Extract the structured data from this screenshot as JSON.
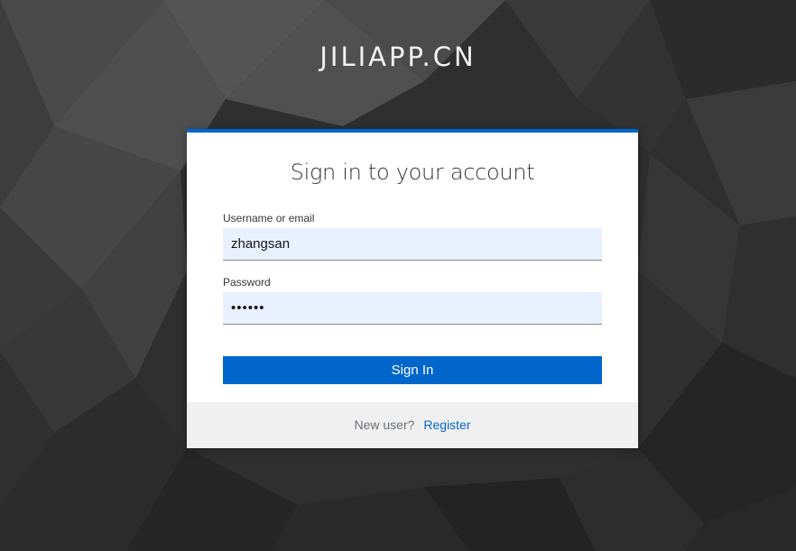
{
  "brand": {
    "title": "JILIAPP.CN"
  },
  "login": {
    "heading": "Sign in to your account",
    "username_label": "Username or email",
    "username_value": "zhangsan",
    "password_label": "Password",
    "password_display": "••••••",
    "signin_label": "Sign In",
    "new_user_text": "New user?",
    "register_label": "Register"
  },
  "colors": {
    "accent": "#0066cc",
    "background": "#2e2e2e",
    "input_fill": "#e8f0fe",
    "footer_fill": "#f0f0f0"
  }
}
